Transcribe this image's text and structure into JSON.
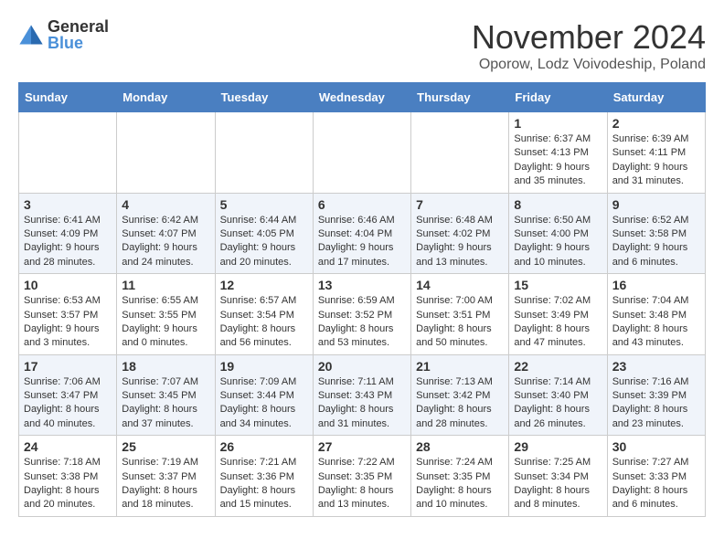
{
  "header": {
    "logo_general": "General",
    "logo_blue": "Blue",
    "month_title": "November 2024",
    "location": "Oporow, Lodz Voivodeship, Poland"
  },
  "days_of_week": [
    "Sunday",
    "Monday",
    "Tuesday",
    "Wednesday",
    "Thursday",
    "Friday",
    "Saturday"
  ],
  "weeks": [
    [
      {
        "day": "",
        "info": ""
      },
      {
        "day": "",
        "info": ""
      },
      {
        "day": "",
        "info": ""
      },
      {
        "day": "",
        "info": ""
      },
      {
        "day": "",
        "info": ""
      },
      {
        "day": "1",
        "info": "Sunrise: 6:37 AM\nSunset: 4:13 PM\nDaylight: 9 hours and 35 minutes."
      },
      {
        "day": "2",
        "info": "Sunrise: 6:39 AM\nSunset: 4:11 PM\nDaylight: 9 hours and 31 minutes."
      }
    ],
    [
      {
        "day": "3",
        "info": "Sunrise: 6:41 AM\nSunset: 4:09 PM\nDaylight: 9 hours and 28 minutes."
      },
      {
        "day": "4",
        "info": "Sunrise: 6:42 AM\nSunset: 4:07 PM\nDaylight: 9 hours and 24 minutes."
      },
      {
        "day": "5",
        "info": "Sunrise: 6:44 AM\nSunset: 4:05 PM\nDaylight: 9 hours and 20 minutes."
      },
      {
        "day": "6",
        "info": "Sunrise: 6:46 AM\nSunset: 4:04 PM\nDaylight: 9 hours and 17 minutes."
      },
      {
        "day": "7",
        "info": "Sunrise: 6:48 AM\nSunset: 4:02 PM\nDaylight: 9 hours and 13 minutes."
      },
      {
        "day": "8",
        "info": "Sunrise: 6:50 AM\nSunset: 4:00 PM\nDaylight: 9 hours and 10 minutes."
      },
      {
        "day": "9",
        "info": "Sunrise: 6:52 AM\nSunset: 3:58 PM\nDaylight: 9 hours and 6 minutes."
      }
    ],
    [
      {
        "day": "10",
        "info": "Sunrise: 6:53 AM\nSunset: 3:57 PM\nDaylight: 9 hours and 3 minutes."
      },
      {
        "day": "11",
        "info": "Sunrise: 6:55 AM\nSunset: 3:55 PM\nDaylight: 9 hours and 0 minutes."
      },
      {
        "day": "12",
        "info": "Sunrise: 6:57 AM\nSunset: 3:54 PM\nDaylight: 8 hours and 56 minutes."
      },
      {
        "day": "13",
        "info": "Sunrise: 6:59 AM\nSunset: 3:52 PM\nDaylight: 8 hours and 53 minutes."
      },
      {
        "day": "14",
        "info": "Sunrise: 7:00 AM\nSunset: 3:51 PM\nDaylight: 8 hours and 50 minutes."
      },
      {
        "day": "15",
        "info": "Sunrise: 7:02 AM\nSunset: 3:49 PM\nDaylight: 8 hours and 47 minutes."
      },
      {
        "day": "16",
        "info": "Sunrise: 7:04 AM\nSunset: 3:48 PM\nDaylight: 8 hours and 43 minutes."
      }
    ],
    [
      {
        "day": "17",
        "info": "Sunrise: 7:06 AM\nSunset: 3:47 PM\nDaylight: 8 hours and 40 minutes."
      },
      {
        "day": "18",
        "info": "Sunrise: 7:07 AM\nSunset: 3:45 PM\nDaylight: 8 hours and 37 minutes."
      },
      {
        "day": "19",
        "info": "Sunrise: 7:09 AM\nSunset: 3:44 PM\nDaylight: 8 hours and 34 minutes."
      },
      {
        "day": "20",
        "info": "Sunrise: 7:11 AM\nSunset: 3:43 PM\nDaylight: 8 hours and 31 minutes."
      },
      {
        "day": "21",
        "info": "Sunrise: 7:13 AM\nSunset: 3:42 PM\nDaylight: 8 hours and 28 minutes."
      },
      {
        "day": "22",
        "info": "Sunrise: 7:14 AM\nSunset: 3:40 PM\nDaylight: 8 hours and 26 minutes."
      },
      {
        "day": "23",
        "info": "Sunrise: 7:16 AM\nSunset: 3:39 PM\nDaylight: 8 hours and 23 minutes."
      }
    ],
    [
      {
        "day": "24",
        "info": "Sunrise: 7:18 AM\nSunset: 3:38 PM\nDaylight: 8 hours and 20 minutes."
      },
      {
        "day": "25",
        "info": "Sunrise: 7:19 AM\nSunset: 3:37 PM\nDaylight: 8 hours and 18 minutes."
      },
      {
        "day": "26",
        "info": "Sunrise: 7:21 AM\nSunset: 3:36 PM\nDaylight: 8 hours and 15 minutes."
      },
      {
        "day": "27",
        "info": "Sunrise: 7:22 AM\nSunset: 3:35 PM\nDaylight: 8 hours and 13 minutes."
      },
      {
        "day": "28",
        "info": "Sunrise: 7:24 AM\nSunset: 3:35 PM\nDaylight: 8 hours and 10 minutes."
      },
      {
        "day": "29",
        "info": "Sunrise: 7:25 AM\nSunset: 3:34 PM\nDaylight: 8 hours and 8 minutes."
      },
      {
        "day": "30",
        "info": "Sunrise: 7:27 AM\nSunset: 3:33 PM\nDaylight: 8 hours and 6 minutes."
      }
    ]
  ],
  "colors": {
    "header_bg": "#4a7fc1",
    "header_text": "#ffffff",
    "odd_row_bg": "#ffffff",
    "even_row_bg": "#f0f4fa"
  }
}
